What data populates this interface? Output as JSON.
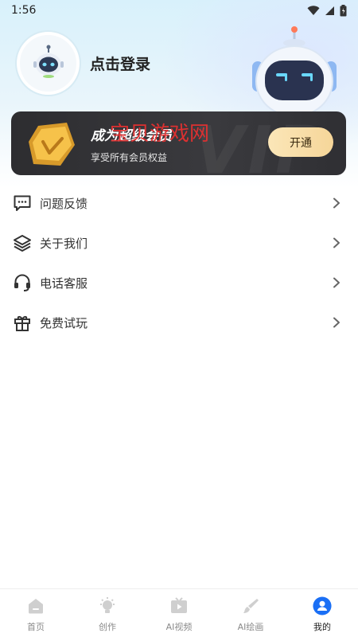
{
  "status_bar": {
    "time": "1:56",
    "icons": [
      "wifi-icon",
      "signal-icon",
      "battery-icon"
    ]
  },
  "profile": {
    "login_label": "点击登录"
  },
  "vip": {
    "title": "成为超级会员",
    "subtitle": "享受所有会员权益",
    "open_button": "开通",
    "watermark_text": "VIP",
    "overlay_text": "宝贝游戏网",
    "colors": {
      "card": "#2d2d30",
      "button": "#f6d699",
      "overlay": "#e53030"
    }
  },
  "menu": {
    "items": [
      {
        "label": "问题反馈",
        "icon": "feedback-icon"
      },
      {
        "label": "关于我们",
        "icon": "layers-icon"
      },
      {
        "label": "电话客服",
        "icon": "headset-icon"
      },
      {
        "label": "免费试玩",
        "icon": "gift-icon"
      }
    ]
  },
  "bottom_nav": {
    "items": [
      {
        "label": "首页",
        "icon": "home-icon",
        "active": false
      },
      {
        "label": "创作",
        "icon": "lightbulb-icon",
        "active": false
      },
      {
        "label": "AI视频",
        "icon": "video-icon",
        "active": false
      },
      {
        "label": "AI绘画",
        "icon": "brush-icon",
        "active": false
      },
      {
        "label": "我的",
        "icon": "user-icon",
        "active": true
      }
    ],
    "active_color": "#1a6ff5"
  }
}
